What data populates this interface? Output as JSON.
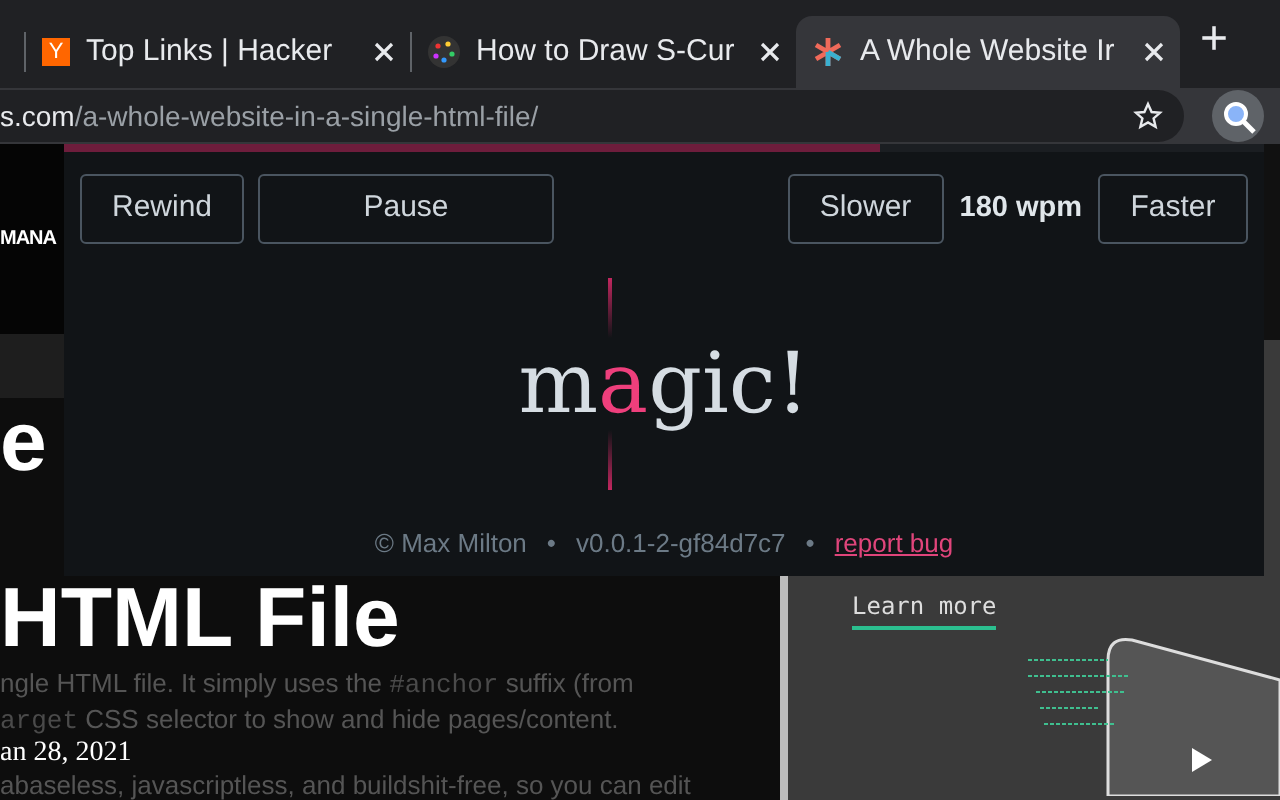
{
  "tabs": [
    {
      "title": "Top Links | Hacker",
      "kind": "letter",
      "favicon_text": "Y",
      "selected": false
    },
    {
      "title": "How to Draw S-Cur",
      "kind": "dots",
      "selected": false
    },
    {
      "title": "A Whole Website Ir",
      "kind": "asterisk",
      "selected": true
    }
  ],
  "new_tab": "+",
  "address_bar": {
    "host": "s.com",
    "path": "/a-whole-website-in-a-single-html-file/"
  },
  "page": {
    "nav_text": "MANA",
    "heading_lines": [
      "e",
      "HTML File"
    ],
    "paragraph_1": [
      {
        "kind": "text",
        "text": "ngle HTML file. It simply uses the "
      },
      {
        "kind": "code",
        "text": "#anchor"
      },
      {
        "kind": "text",
        "text": " suffix (from"
      }
    ],
    "paragraph_2": [
      {
        "kind": "code",
        "text": "arget"
      },
      {
        "kind": "text",
        "text": " CSS selector to show and hide pages/content."
      }
    ],
    "date": "an 28, 2021",
    "paragraph_3": "abaseless, javascriptless, and buildshit-free, so you can edit",
    "promo": {
      "link": "Learn more"
    }
  },
  "reader": {
    "progress": {
      "level": 0.68
    },
    "buttons_left": [
      "Rewind",
      "Pause"
    ],
    "slower": "Slower",
    "speed": "180 wpm",
    "faster": "Faster",
    "word": {
      "before": "m",
      "focus": "a",
      "after": "gic!"
    },
    "footer": {
      "author": "© Max Milton",
      "separator_1": "•",
      "version": "v0.0.1-2-gf84d7c7",
      "separator_2": "•",
      "link": "report bug"
    }
  }
}
